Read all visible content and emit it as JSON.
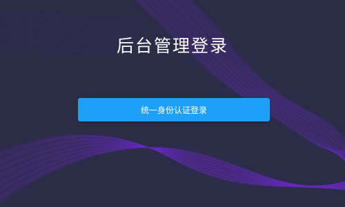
{
  "login": {
    "title": "后台管理登录",
    "sso_button_label": "统一身份认证登录"
  },
  "colors": {
    "background": "#2b2c47",
    "wave_purple": "#6a2bc2",
    "button_blue": "#1ea0f6"
  }
}
